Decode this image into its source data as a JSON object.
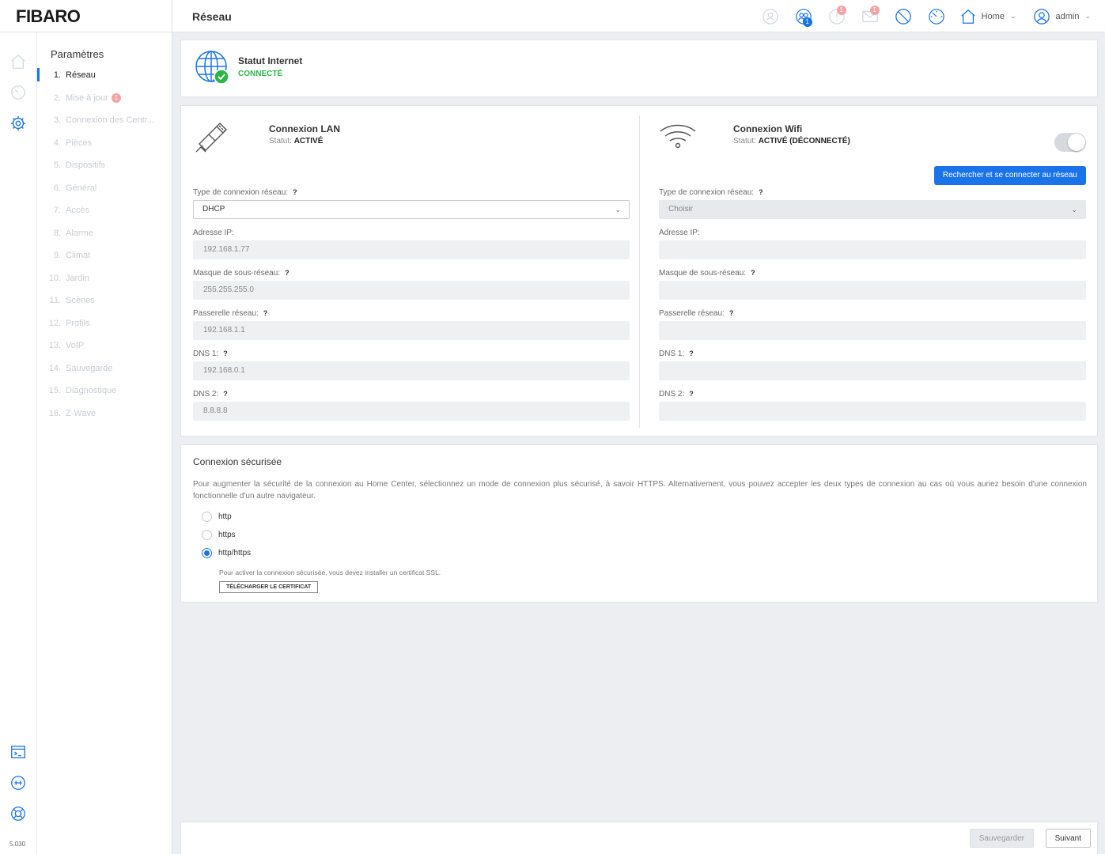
{
  "app": {
    "logo": "FIBARO",
    "page_title": "Réseau",
    "version": "5.030"
  },
  "header": {
    "icons": [
      {
        "name": "user-icon",
        "badge": ""
      },
      {
        "name": "users-icon",
        "badge": "1"
      },
      {
        "name": "notification-icon",
        "badge": "1"
      },
      {
        "name": "mail-icon",
        "badge": "1"
      },
      {
        "name": "forbidden-icon",
        "badge": ""
      },
      {
        "name": "gauge-icon",
        "badge": ""
      }
    ],
    "home_label": "Home",
    "user_label": "admin"
  },
  "rail": {
    "top_icons": [
      "home-icon",
      "dashboard-icon",
      "gear-icon"
    ],
    "bottom_icons": [
      "terminal-icon",
      "plugin-icon",
      "help-icon"
    ]
  },
  "settings_nav": {
    "title": "Paramètres",
    "items": [
      {
        "num": "1.",
        "label": "Réseau",
        "active": true,
        "badge": ""
      },
      {
        "num": "2.",
        "label": "Mise à jour",
        "active": false,
        "badge": "1"
      },
      {
        "num": "3.",
        "label": "Connexion des Centr...",
        "active": false,
        "badge": ""
      },
      {
        "num": "4.",
        "label": "Pièces",
        "active": false,
        "badge": ""
      },
      {
        "num": "5.",
        "label": "Dispositifs",
        "active": false,
        "badge": ""
      },
      {
        "num": "6.",
        "label": "Général",
        "active": false,
        "badge": ""
      },
      {
        "num": "7.",
        "label": "Accès",
        "active": false,
        "badge": ""
      },
      {
        "num": "8.",
        "label": "Alarme",
        "active": false,
        "badge": ""
      },
      {
        "num": "9.",
        "label": "Climat",
        "active": false,
        "badge": ""
      },
      {
        "num": "10.",
        "label": "Jardin",
        "active": false,
        "badge": ""
      },
      {
        "num": "11.",
        "label": "Scènes",
        "active": false,
        "badge": ""
      },
      {
        "num": "12.",
        "label": "Profils",
        "active": false,
        "badge": ""
      },
      {
        "num": "13.",
        "label": "VoIP",
        "active": false,
        "badge": ""
      },
      {
        "num": "14.",
        "label": "Sauvegarde",
        "active": false,
        "badge": ""
      },
      {
        "num": "15.",
        "label": "Diagnostique",
        "active": false,
        "badge": ""
      },
      {
        "num": "16.",
        "label": "Z-Wave",
        "active": false,
        "badge": ""
      }
    ]
  },
  "internet": {
    "title": "Statut Internet",
    "status": "CONNECTÉ",
    "status_color": "#2fb44a"
  },
  "lan": {
    "title": "Connexion LAN",
    "status_label": "Statut:",
    "status_value": "ACTIVÉ",
    "conn_type_label": "Type de connexion réseau:",
    "conn_type_value": "DHCP",
    "ip_label": "Adresse IP:",
    "ip_value": "192.168.1.77",
    "mask_label": "Masque de sous-réseau:",
    "mask_value": "255.255.255.0",
    "gateway_label": "Passerelle réseau:",
    "gateway_value": "192.168.1.1",
    "dns1_label": "DNS 1:",
    "dns1_value": "192.168.0.1",
    "dns2_label": "DNS 2:",
    "dns2_value": "8.8.8.8"
  },
  "wifi": {
    "title": "Connexion Wifi",
    "status_label": "Statut:",
    "status_value": "ACTIVÉ (DÉCONNECTÉ)",
    "scan_button": "Rechercher et se connecter au réseau",
    "conn_type_label": "Type de connexion réseau:",
    "conn_type_value": "Choisir",
    "ip_label": "Adresse IP:",
    "ip_value": "",
    "mask_label": "Masque de sous-réseau:",
    "mask_value": "",
    "gateway_label": "Passerelle réseau:",
    "gateway_value": "",
    "dns1_label": "DNS 1:",
    "dns1_value": "",
    "dns2_label": "DNS 2:",
    "dns2_value": ""
  },
  "help_mark": "?",
  "secure": {
    "title": "Connexion sécurisée",
    "description": "Pour augmenter la sécurité de la connexion au Home Center, sélectionnez un mode de connexion plus sécurisé, à savoir HTTPS. Alternativement, vous pouvez accepter les deux types de connexion au cas où vous auriez besoin d'une connexion fonctionnelle d'un autre navigateur.",
    "options": [
      {
        "label": "http",
        "selected": false
      },
      {
        "label": "https",
        "selected": false
      },
      {
        "label": "http/https",
        "selected": true
      }
    ],
    "ssl_note": "Pour activer la connexion sécurisée, vous devez installer un certificat SSL.",
    "cert_button": "TÉLÉCHARGER LE CERTIFICAT"
  },
  "footer": {
    "save_label": "Sauvegarder",
    "next_label": "Suivant"
  },
  "colors": {
    "accent": "#1a73e8",
    "badge": "#f3a3a3",
    "success": "#2fb44a"
  }
}
